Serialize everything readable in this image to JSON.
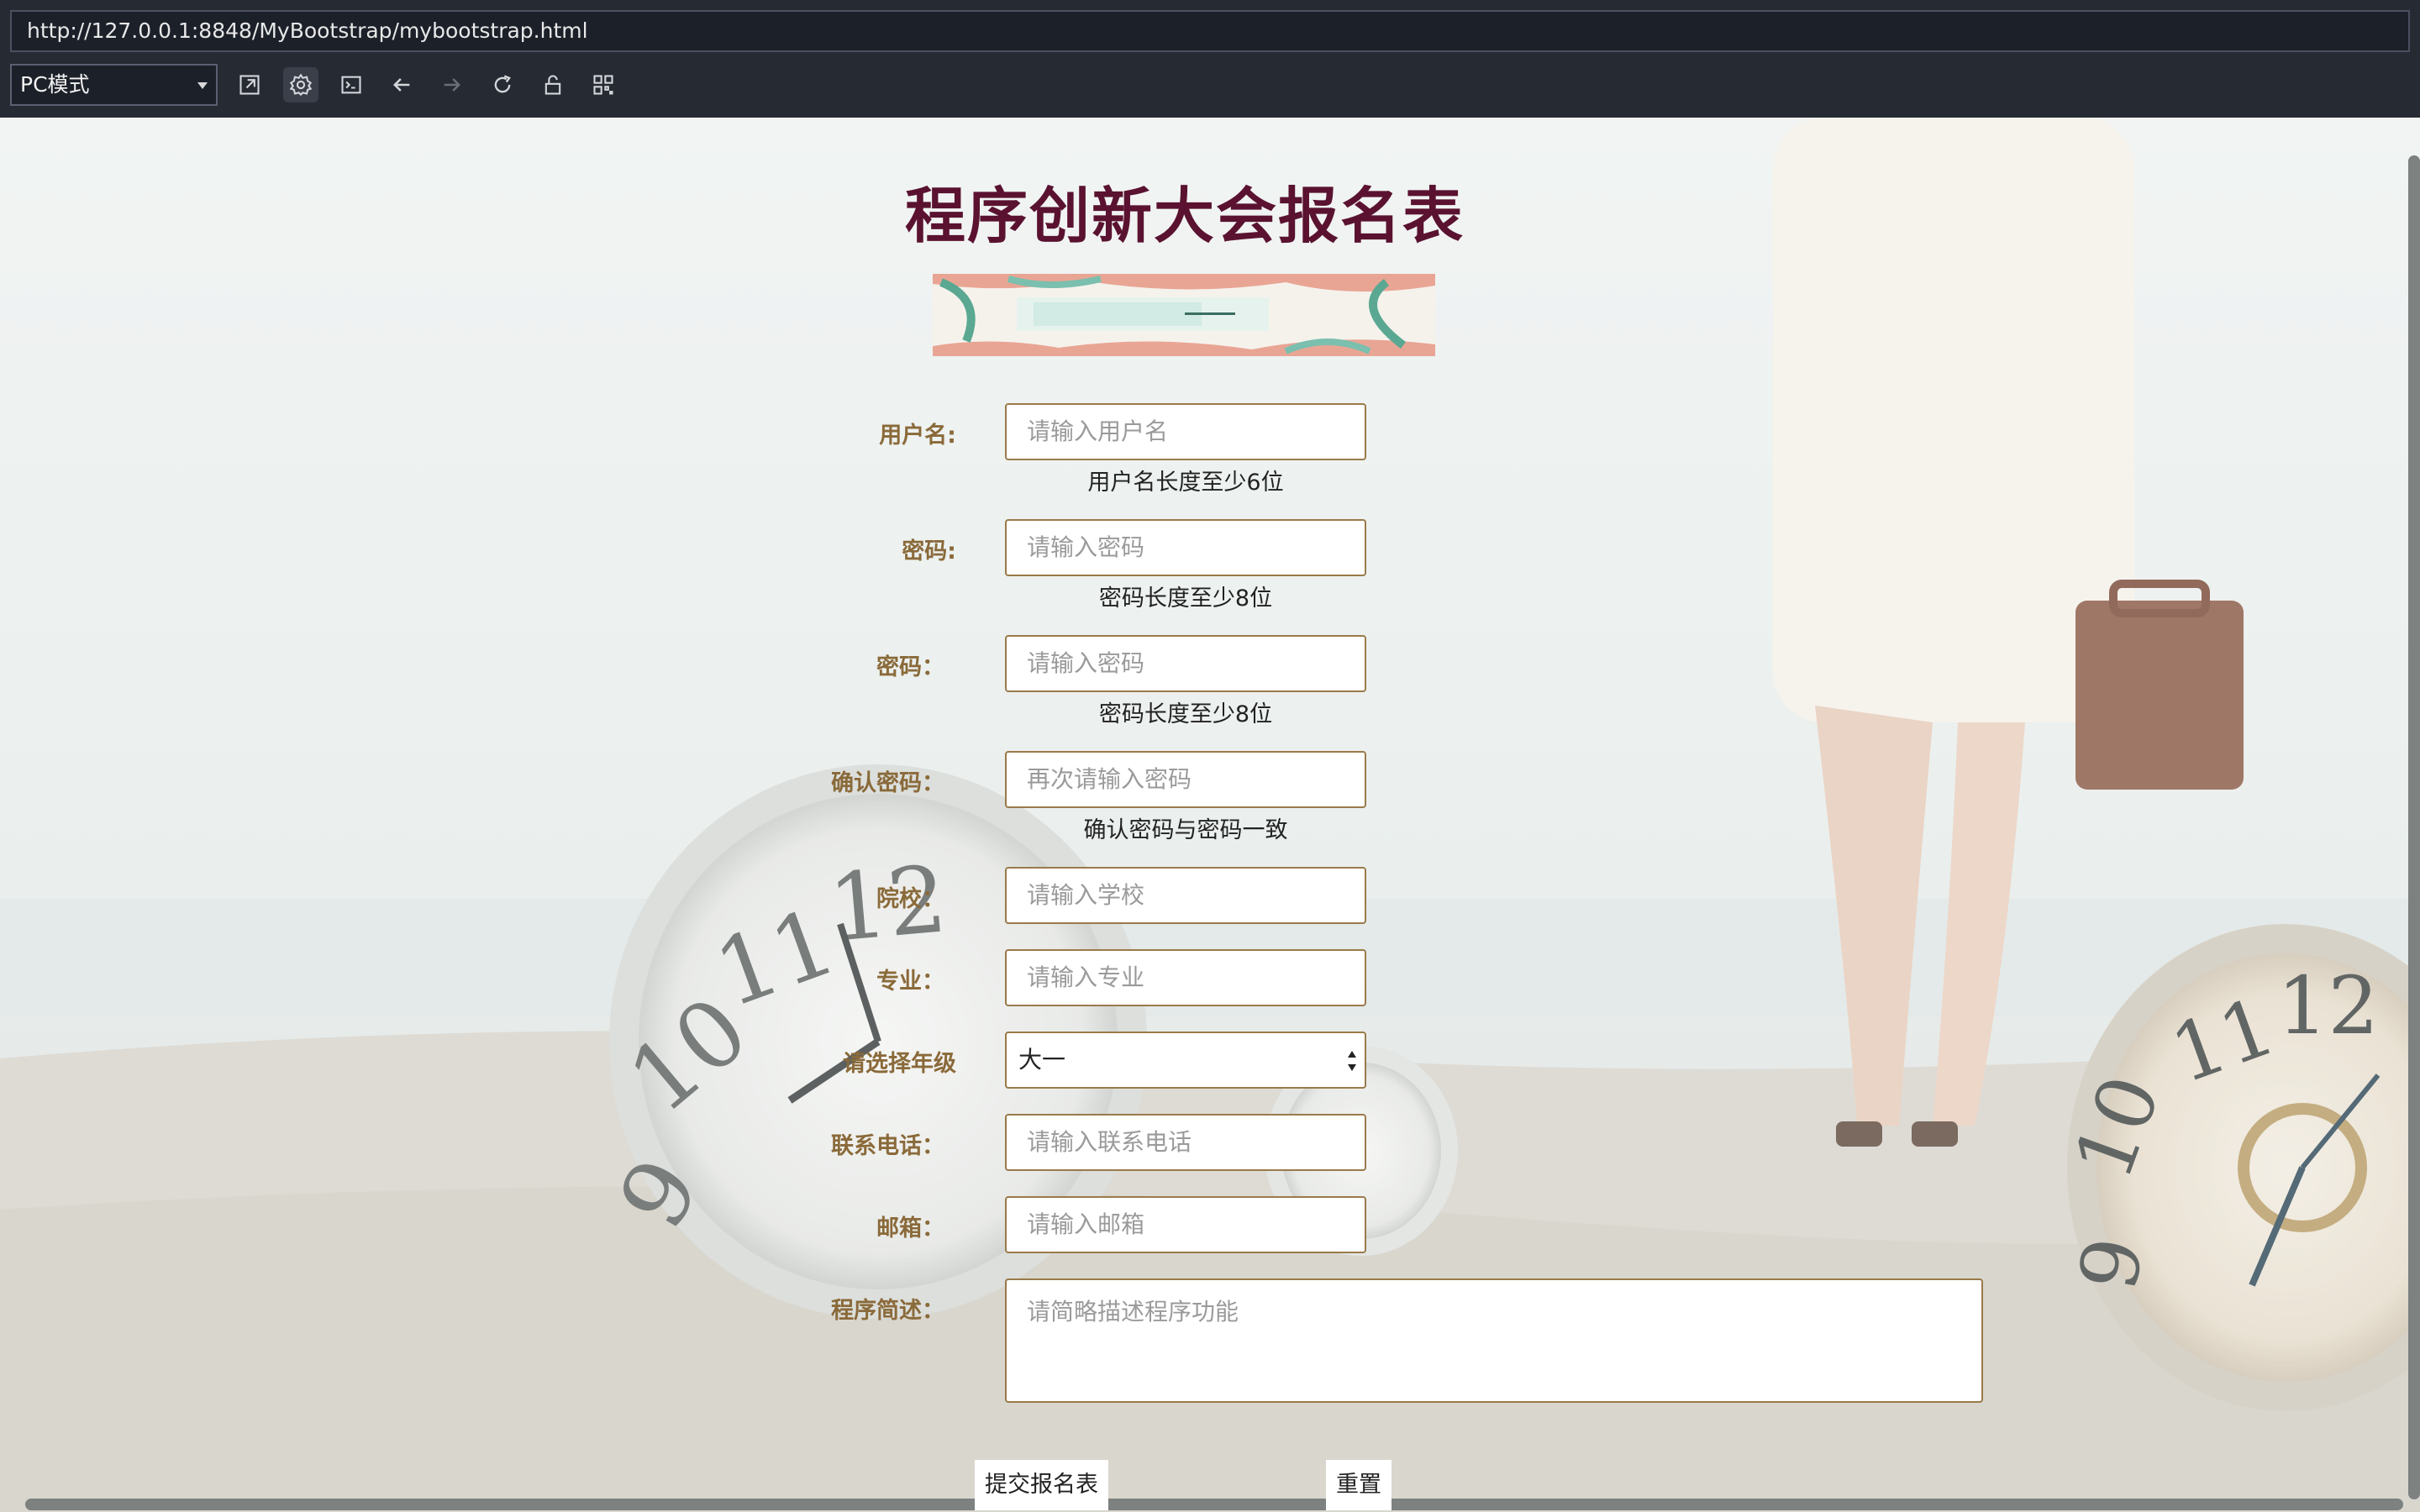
{
  "browser": {
    "url": "http://127.0.0.1:8848/MyBootstrap/mybootstrap.html",
    "mode": "PC模式",
    "toolbar_icons": [
      "open-external-icon",
      "settings-icon",
      "console-icon",
      "back-arrow-icon",
      "forward-arrow-icon",
      "reload-icon",
      "unlock-icon",
      "qr-code-icon"
    ]
  },
  "page": {
    "title": "程序创新大会报名表",
    "form": {
      "username": {
        "label": "用户名:",
        "placeholder": "请输入用户名",
        "hint": "用户名长度至少6位"
      },
      "password": {
        "label": "密码:",
        "placeholder": "请输入密码",
        "hint": "密码长度至少8位"
      },
      "password2": {
        "label": "密码：",
        "placeholder": "请输入密码",
        "hint": "密码长度至少8位"
      },
      "confirm": {
        "label": "确认密码：",
        "placeholder": "再次请输入密码",
        "hint": "确认密码与密码一致"
      },
      "school": {
        "label": "院校：",
        "placeholder": "请输入学校"
      },
      "major": {
        "label": "专业：",
        "placeholder": "请输入专业"
      },
      "grade": {
        "label": "请选择年级",
        "value": "大一"
      },
      "phone": {
        "label": "联系电话：",
        "placeholder": "请输入联系电话"
      },
      "email": {
        "label": "邮箱：",
        "placeholder": "请输入邮箱"
      },
      "description": {
        "label": "程序简述：",
        "placeholder": "请简略描述程序功能"
      }
    },
    "buttons": {
      "submit": "提交报名表",
      "reset": "重置"
    }
  },
  "colors": {
    "title": "#5a1230",
    "label": "#8a6a3a",
    "field_border": "#9a7a4a",
    "chrome": "#252a33"
  }
}
